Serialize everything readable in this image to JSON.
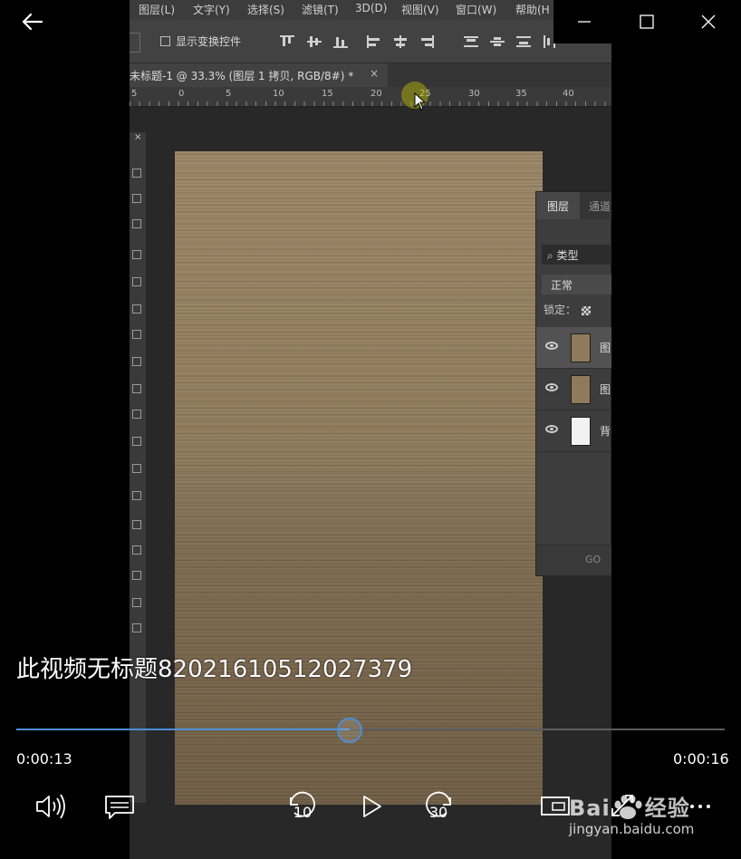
{
  "window": {
    "back_icon": "arrow-left-icon",
    "minimize_icon": "minimize-icon",
    "maximize_icon": "maximize-icon",
    "close_icon": "close-icon"
  },
  "video": {
    "app": "Photoshop",
    "menu": [
      "图层(L)",
      "文字(Y)",
      "选择(S)",
      "滤镜(T)",
      "3D(D)",
      "视图(V)",
      "窗口(W)",
      "帮助(H"
    ],
    "options_bar": {
      "checkbox_label": "显示变换控件"
    },
    "doc_tab": {
      "title": "未标题-1 @ 33.3% (图层 1 拷贝, RGB/8#) *",
      "close": "×"
    },
    "ruler": [
      "5",
      "0",
      "5",
      "10",
      "15",
      "20",
      "25",
      "30",
      "35",
      "40"
    ],
    "toolbar_close": "×",
    "layers_panel": {
      "tab_active": "图层",
      "tab_inactive": "通道",
      "filter": "类型",
      "blend_mode": "正常",
      "lock_label": "锁定：",
      "layers": [
        {
          "name": "图",
          "selected": true,
          "thumb": "#8f7a5b"
        },
        {
          "name": "图",
          "selected": false,
          "thumb": "#8f7a5b"
        },
        {
          "name": "背",
          "selected": false,
          "thumb": "#f2f2f2"
        }
      ],
      "link_icon": "GO"
    }
  },
  "player": {
    "title": "此视频无标题82021610512027379",
    "time_current": "0:00:13",
    "time_total": "0:00:16",
    "progress": 0.47,
    "accent": "#4c8fd6",
    "controls": {
      "volume_icon": "volume-icon",
      "captions_icon": "captions-icon",
      "skip_back_label": "10",
      "play_icon": "play-icon",
      "skip_forward_label": "30",
      "mini_view_icon": "mini-view-icon",
      "fullscreen_icon": "fullscreen-icon",
      "more_icon": "more-icon"
    }
  },
  "watermark": {
    "brand_left": "Bai",
    "brand_right": "经验",
    "url": "jingyan.baidu.com"
  }
}
